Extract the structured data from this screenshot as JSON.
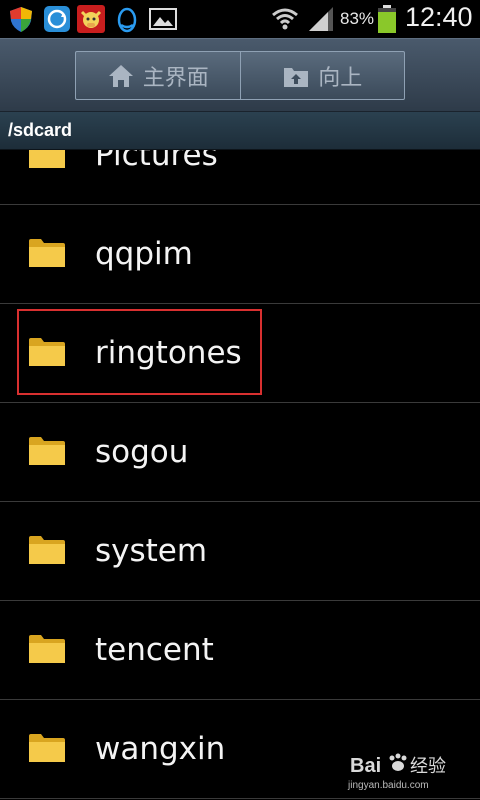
{
  "status_bar": {
    "battery_percent": "83%",
    "time": "12:40",
    "icons": [
      "shield-icon",
      "sync-icon",
      "cow-app-icon",
      "qq-icon",
      "image-icon",
      "wifi-icon",
      "signal-icon",
      "battery-icon"
    ],
    "battery_color": "#8ac82a"
  },
  "action_bar": {
    "home_label": "主界面",
    "up_label": "向上"
  },
  "path": "/sdcard",
  "files": [
    {
      "name": "Pictures",
      "icon": "folder-icon"
    },
    {
      "name": "qqpim",
      "icon": "folder-icon"
    },
    {
      "name": "ringtones",
      "icon": "folder-icon"
    },
    {
      "name": "sogou",
      "icon": "folder-icon"
    },
    {
      "name": "system",
      "icon": "folder-icon"
    },
    {
      "name": "tencent",
      "icon": "folder-icon"
    },
    {
      "name": "wangxin",
      "icon": "folder-icon"
    }
  ],
  "watermark": {
    "logo_text": "Bai 经验",
    "url": "jingyan.baidu.com"
  },
  "colors": {
    "highlight": "#d93030",
    "folder": "#f2c94c"
  }
}
